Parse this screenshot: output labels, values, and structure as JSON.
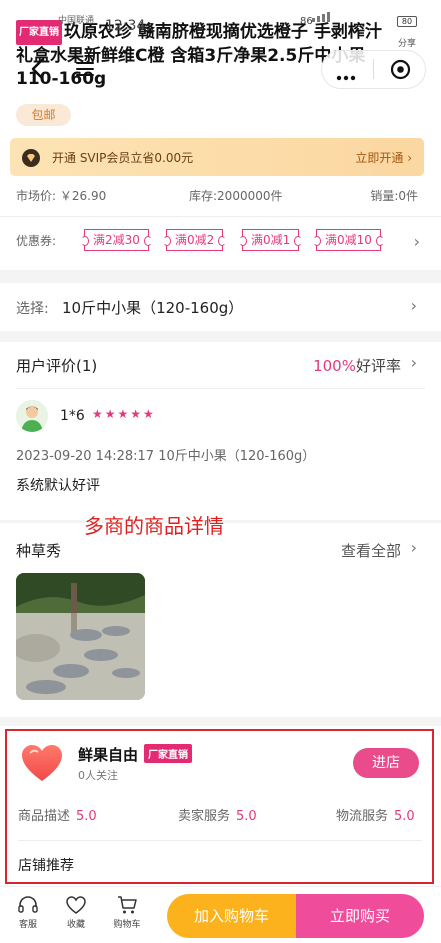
{
  "status_bar": {
    "carrier": "中国联通",
    "time": "12:34",
    "network": "86",
    "battery": "80"
  },
  "header": {
    "share_label": "分享"
  },
  "product": {
    "badge": "厂家直销",
    "title": "玖原农珍 赣南脐橙现摘优选橙子 手剥榨汁礼盒水果新鲜维C橙 含箱3斤净果2.5斤中小果110-160g",
    "shipping_tag": "包邮"
  },
  "svip": {
    "text": "开通 SVIP会员立省0.00元",
    "cta": "立即开通 ›"
  },
  "stats": {
    "market_price": "市场价: ￥26.90",
    "stock": "库存:2000000件",
    "sales": "销量:0件"
  },
  "coupons": {
    "label": "优惠券:",
    "items": [
      "满2减30",
      "满0减2",
      "满0减1",
      "满0减10"
    ]
  },
  "spec": {
    "label": "选择:",
    "value": "10斤中小果（120-160g）"
  },
  "reviews": {
    "title": "用户评价(1)",
    "rate_value": "100%",
    "rate_label": "好评率",
    "reviewer": "1*6",
    "stars": "★★★★★",
    "meta": "2023-09-20 14:28:17 10斤中小果（120-160g）",
    "body": "系统默认好评"
  },
  "annotation": "多商的商品详情",
  "grass": {
    "title": "种草秀",
    "view_all": "查看全部"
  },
  "shop": {
    "name": "鲜果自由",
    "badge": "厂家直销",
    "followers": "0人关注",
    "enter": "进店",
    "ratings": [
      {
        "label": "商品描述",
        "value": "5.0"
      },
      {
        "label": "卖家服务",
        "value": "5.0"
      },
      {
        "label": "物流服务",
        "value": "5.0"
      }
    ],
    "recommend": "店铺推荐"
  },
  "bottom_bar": {
    "tabs": [
      "客服",
      "收藏",
      "购物车"
    ],
    "add_to_cart": "加入购物车",
    "buy_now": "立即购买"
  },
  "colors": {
    "accent_pink": "#e3397f",
    "buy_button": "#ef4d9b",
    "cart_button": "#fbb21c",
    "annotation_red": "#e02020"
  }
}
